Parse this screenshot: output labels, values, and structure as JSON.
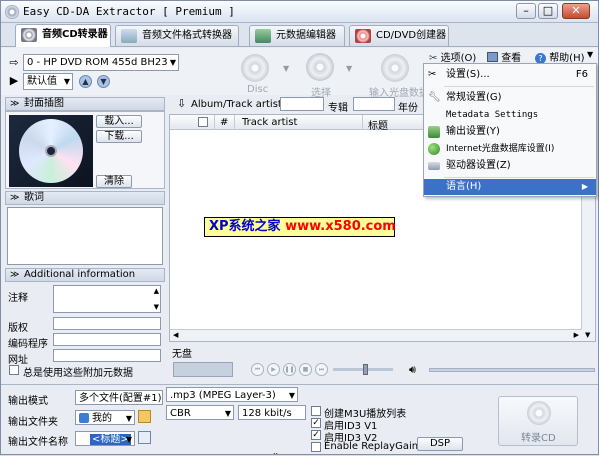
{
  "window": {
    "title": "Easy CD-DA Extractor [ Premium ]",
    "controls": [
      "min",
      "max",
      "close"
    ]
  },
  "tabs": [
    {
      "label": "音频CD转录器"
    },
    {
      "label": "音频文件格式转换器"
    },
    {
      "label": "元数据编辑器"
    },
    {
      "label": "CD/DVD创建器"
    }
  ],
  "toolbar": {
    "drive": "0 - HP DVD ROM 455d BH23",
    "preset": "默认值",
    "disc_label": "Disc",
    "select_label": "选择",
    "input_label": "输入光盘数据",
    "options_label": "选项(O)",
    "view_label": "查看",
    "help_label": "帮助(H)"
  },
  "menu": {
    "items": [
      {
        "label": "设置(S)...",
        "shortcut": "F6"
      },
      {
        "label": "常规设置(G)",
        "shortcut": ""
      },
      {
        "label": "Metadata Settings",
        "shortcut": ""
      },
      {
        "label": "输出设置(Y)",
        "shortcut": ""
      },
      {
        "label": "Internet光盘数据库设置(I)",
        "shortcut": ""
      },
      {
        "label": "驱动器设置(Z)",
        "shortcut": ""
      },
      {
        "label": "语言(H)",
        "shortcut": ""
      }
    ]
  },
  "cover": {
    "header": "封面插图",
    "load": "载入...",
    "download": "下载...",
    "clear": "清除"
  },
  "lyrics": {
    "header": "歌词"
  },
  "additional": {
    "header": "Additional information",
    "comment": "注释",
    "copyright": "版权",
    "encoder": "编码程序",
    "url": "网址",
    "always_add": "总是使用这些附加元数据"
  },
  "tracks": {
    "album_artist_label": "Album/Track artists",
    "album_label": "专辑",
    "year_label": "年份",
    "columns": [
      "#",
      "Track artist",
      "标题"
    ],
    "no_disc": "无盘"
  },
  "output": {
    "mode_label": "输出模式",
    "mode_value": "多个文件(配置#1)",
    "folder_label": "输出文件夹",
    "folder_value": "我的",
    "filename_label": "输出文件名称",
    "filename_value": "<标题>",
    "format": ".mp3 (MPEG Layer-3)",
    "rate_mode": "CBR",
    "bitrate": "128 kbit/s",
    "opt_m3u": "创建M3U播放列表",
    "opt_id3v1": "启用ID3 V1",
    "opt_id3v2": "启用ID3 V2",
    "opt_replaygain": "Enable ReplayGain",
    "dsp": "DSP",
    "rip": "转录CD"
  },
  "watermark": {
    "part1": "XP系统之家 ",
    "part2": "www.x580.com"
  },
  "colors": {
    "menu_highlight": "#3b72c8",
    "banner_bg": "#ffff9a",
    "banner_blue": "#0000c8",
    "banner_red": "#ff0000"
  }
}
